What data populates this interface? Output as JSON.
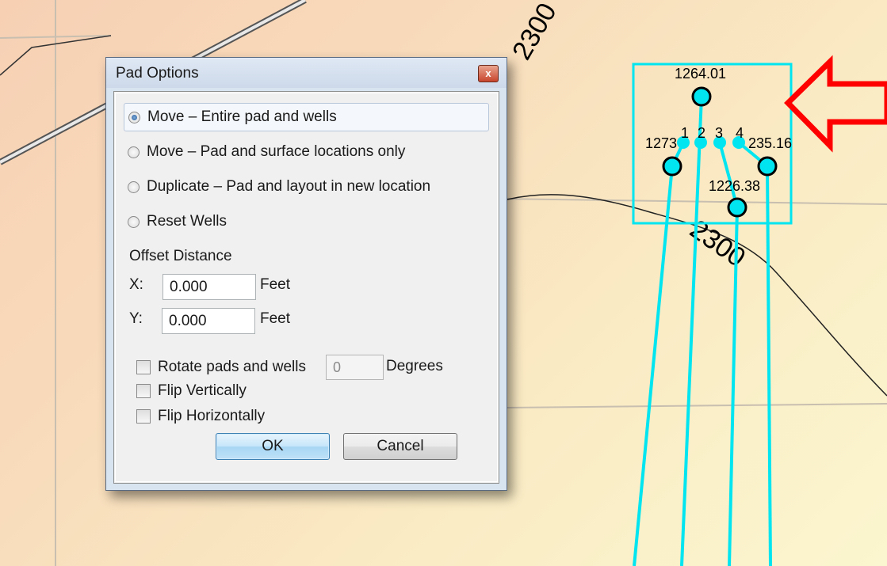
{
  "map": {
    "contour_labels": [
      "2300",
      "2300"
    ],
    "well_depths": [
      "1264.01",
      "1273",
      "235.16",
      "1226.38"
    ],
    "well_numbers": [
      "1",
      "2",
      "3",
      "4"
    ],
    "colors": {
      "pad": "#00e5f0",
      "arrow": "#ff0000",
      "contour": "#000000",
      "road": "#8a8a8a"
    }
  },
  "dialog": {
    "title": "Pad Options",
    "close_glyph": "x",
    "options": [
      {
        "label": "Move – Entire pad and wells",
        "checked": true
      },
      {
        "label": "Move – Pad and surface locations only",
        "checked": false
      },
      {
        "label": "Duplicate – Pad and layout in new location",
        "checked": false
      },
      {
        "label": "Reset Wells",
        "checked": false
      }
    ],
    "offset": {
      "heading": "Offset Distance",
      "x_label": "X:",
      "x_value": "0.000",
      "y_label": "Y:",
      "y_value": "0.000",
      "unit": "Feet"
    },
    "rotate": {
      "label": "Rotate pads and wells",
      "value": "0",
      "unit": "Degrees",
      "checked": false
    },
    "flip_vertical": {
      "label": "Flip Vertically",
      "checked": false
    },
    "flip_horizontal": {
      "label": "Flip Horizontally",
      "checked": false
    },
    "ok_label": "OK",
    "cancel_label": "Cancel"
  }
}
